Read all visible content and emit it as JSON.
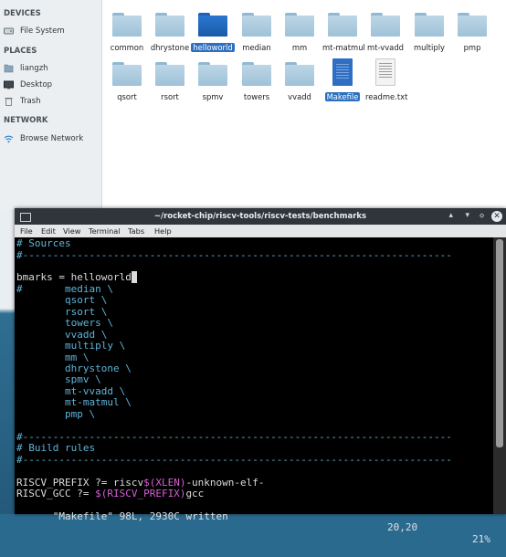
{
  "sidebar": {
    "devices_header": "DEVICES",
    "devices": [
      {
        "label": "File System",
        "icon": "drive-icon"
      }
    ],
    "places_header": "PLACES",
    "places": [
      {
        "label": "liangzh",
        "icon": "home-icon"
      },
      {
        "label": "Desktop",
        "icon": "desktop-icon"
      },
      {
        "label": "Trash",
        "icon": "trash-icon"
      }
    ],
    "network_header": "NETWORK",
    "network": [
      {
        "label": "Browse Network",
        "icon": "wifi-icon"
      }
    ]
  },
  "files": [
    {
      "name": "common",
      "type": "folder"
    },
    {
      "name": "dhrystone",
      "type": "folder"
    },
    {
      "name": "helloworld",
      "type": "folder",
      "selected": true
    },
    {
      "name": "median",
      "type": "folder"
    },
    {
      "name": "mm",
      "type": "folder"
    },
    {
      "name": "mt-matmul",
      "type": "folder"
    },
    {
      "name": "mt-vvadd",
      "type": "folder"
    },
    {
      "name": "multiply",
      "type": "folder"
    },
    {
      "name": "pmp",
      "type": "folder"
    },
    {
      "name": "qsort",
      "type": "folder"
    },
    {
      "name": "rsort",
      "type": "folder"
    },
    {
      "name": "spmv",
      "type": "folder"
    },
    {
      "name": "towers",
      "type": "folder"
    },
    {
      "name": "vvadd",
      "type": "folder"
    },
    {
      "name": "Makefile",
      "type": "makefile",
      "selected": true
    },
    {
      "name": "readme.txt",
      "type": "text"
    }
  ],
  "terminal": {
    "title": "~/rocket-chip/riscv-tools/riscv-tests/benchmarks",
    "menu": [
      "File",
      "Edit",
      "View",
      "Terminal",
      "Tabs",
      "Help"
    ],
    "lines": {
      "l0": "# Sources",
      "l1": "#-----------------------------------------------------------------------",
      "l3": "bmarks = helloworld",
      "l4": "#       median \\",
      "l5": "        qsort \\",
      "l6": "        rsort \\",
      "l7": "        towers \\",
      "l8": "        vvadd \\",
      "l9": "        multiply \\",
      "l10": "        mm \\",
      "l11": "        dhrystone \\",
      "l12": "        spmv \\",
      "l13": "        mt-vvadd \\",
      "l14": "        mt-matmul \\",
      "l15": "        pmp \\",
      "l17": "#-----------------------------------------------------------------------",
      "l18": "# Build rules",
      "l19": "#-----------------------------------------------------------------------",
      "l21a": "RISCV_PREFIX ?= riscv",
      "l21b": "$(XLEN)",
      "l21c": "-unknown-elf-",
      "l22a": "RISCV_GCC ?= ",
      "l22b": "$(RISCV_PREFIX)",
      "l22c": "gcc"
    },
    "status_file": "\"Makefile\" 98L, 2930C written",
    "status_pos": "20,20",
    "status_pct": "21%"
  },
  "colors": {
    "comment": "#5fb4d8",
    "variable": "#d75fd7",
    "selection": "#2d6fc0"
  }
}
